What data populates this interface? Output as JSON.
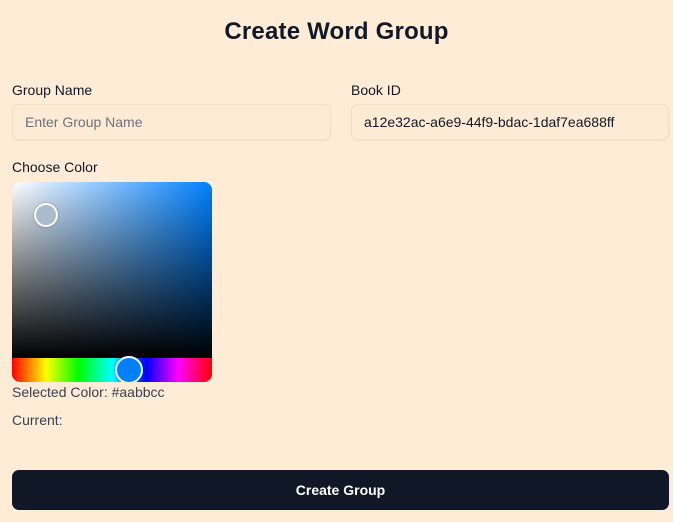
{
  "page": {
    "title": "Create Word Group"
  },
  "form": {
    "group_name": {
      "label": "Group Name",
      "placeholder": "Enter Group Name",
      "value": ""
    },
    "book_id": {
      "label": "Book ID",
      "value": "a12e32ac-a6e9-44f9-bdac-1daf7ea688ff"
    },
    "color": {
      "label": "Choose Color",
      "selected_label": "Selected Color: #aabbcc",
      "selected_hex": "#aabbcc",
      "hue_color": "#0080ff",
      "current_label": "Current:"
    },
    "submit_label": "Create Group"
  },
  "colors": {
    "background": "#feecd6",
    "button": "#101828",
    "button_text": "#ffffff"
  }
}
